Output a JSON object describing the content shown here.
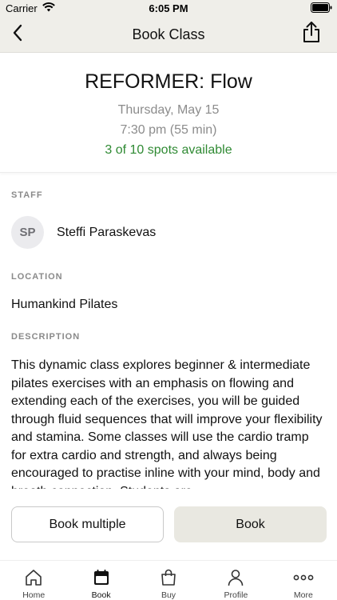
{
  "status_bar": {
    "carrier": "Carrier",
    "time": "6:05 PM"
  },
  "nav": {
    "title": "Book Class",
    "back_icon": "chevron-left-icon",
    "share_icon": "share-icon"
  },
  "class": {
    "title": "REFORMER: Flow",
    "date": "Thursday, May 15",
    "time": "7:30 pm (55 min)",
    "spots": "3 of 10 spots available",
    "spots_color": "#2f8a33"
  },
  "staff": {
    "label": "STAFF",
    "initials": "SP",
    "name": "Steffi Paraskevas"
  },
  "location": {
    "label": "LOCATION",
    "name": "Humankind Pilates"
  },
  "description": {
    "label": "DESCRIPTION",
    "text": "This dynamic class explores beginner & intermediate pilates exercises with an emphasis on flowing and extending each of the exercises, you will be guided through fluid sequences that will improve your flexibility and stamina. Some classes will use the cardio tramp for extra cardio and strength, and always being encouraged to practise inline with your mind, body and breath connection. Students are"
  },
  "actions": {
    "book_multiple": "Book multiple",
    "book": "Book"
  },
  "tabs": [
    {
      "label": "Home",
      "icon": "home-icon"
    },
    {
      "label": "Book",
      "icon": "calendar-icon"
    },
    {
      "label": "Buy",
      "icon": "shopping-bag-icon"
    },
    {
      "label": "Profile",
      "icon": "person-icon"
    },
    {
      "label": "More",
      "icon": "more-dots-icon"
    }
  ],
  "active_tab": "Book"
}
